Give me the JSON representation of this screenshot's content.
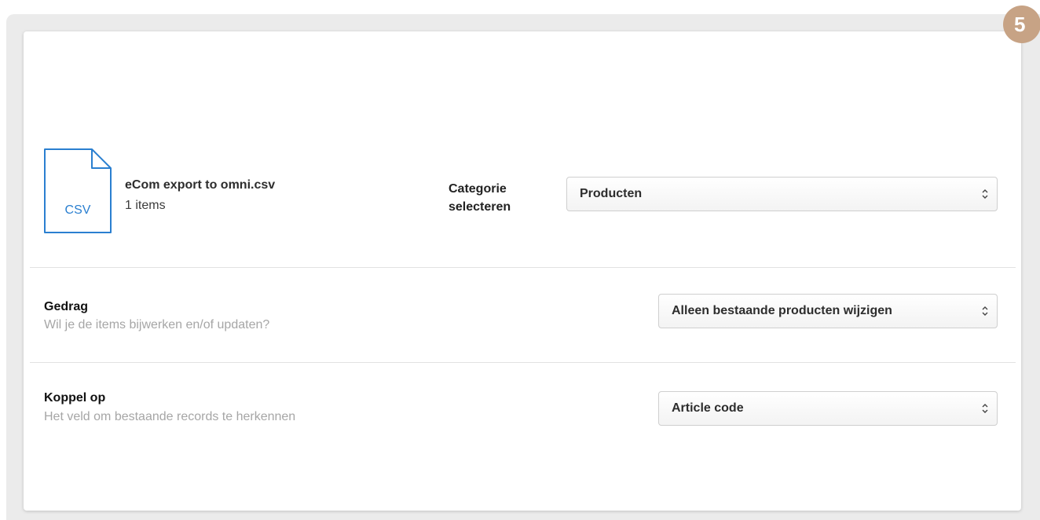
{
  "step": {
    "number": "5",
    "color": "#c7a385"
  },
  "file": {
    "icon": "csv-file-icon",
    "icon_label": "CSV",
    "name": "eCom export to omni.csv",
    "count": "1 items"
  },
  "category": {
    "label": "Categorie selecteren",
    "selected": "Producten"
  },
  "behavior": {
    "title": "Gedrag",
    "subtitle": "Wil je de items bijwerken en/of updaten?",
    "selected": "Alleen bestaande producten wijzigen"
  },
  "link": {
    "title": "Koppel op",
    "subtitle": "Het veld om bestaande records te herkennen",
    "selected": "Article code"
  },
  "colors": {
    "accent": "#2a7fd0",
    "muted": "#a6a6a6"
  }
}
